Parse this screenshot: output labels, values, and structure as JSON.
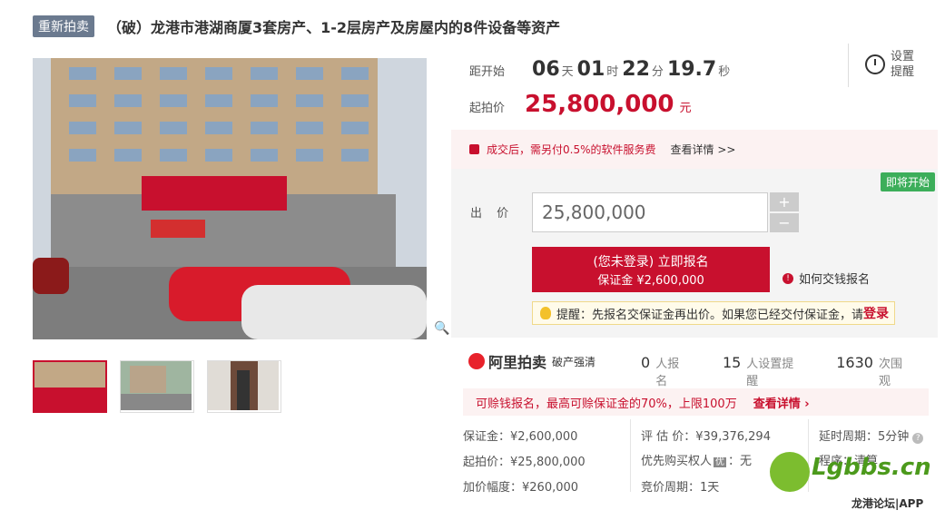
{
  "header": {
    "tag": "重新拍卖",
    "title": "（破）龙港市港湖商厦3套房产、1-2层房产及房屋内的8件设备等资产"
  },
  "countdown": {
    "label": "距开始",
    "days": "06",
    "days_unit": "天",
    "hours": "01",
    "hours_unit": "时",
    "minutes": "22",
    "minutes_unit": "分",
    "seconds": "19.7",
    "seconds_unit": "秒"
  },
  "start_price": {
    "label": "起拍价",
    "value": "25,800,000",
    "unit": "元"
  },
  "reminder": {
    "line1": "设置",
    "line2": "提醒"
  },
  "fee_notice": {
    "text": "成交后，需另付0.5%的软件服务费",
    "link": "查看详情 >>"
  },
  "status_badge": "即将开始",
  "bid": {
    "label": "出 价",
    "value": "25,800,000",
    "plus": "+",
    "minus": "−",
    "signup_line1": "(您未登录) 立即报名",
    "signup_line2": "保证金 ¥2,600,000",
    "how_to": "如何交钱报名"
  },
  "tip": {
    "text": "提醒：先报名交保证金再出价。如果您已经交付保证金，请",
    "login": "登录"
  },
  "brand": {
    "name": "阿里拍卖",
    "sub": "破产强清"
  },
  "stats": [
    {
      "num": "0",
      "label": "人报名"
    },
    {
      "num": "15",
      "label": "人设置提醒"
    },
    {
      "num": "1630",
      "label": "次围观"
    }
  ],
  "refund": {
    "text": "可赊钱报名，最高可赊保证金的70%，上限100万",
    "link": "查看详情 ›"
  },
  "info": {
    "deposit": "保证金：¥2,600,000",
    "start": "起拍价：¥25,800,000",
    "increment": "加价幅度：¥260,000",
    "appraisal": "评 估 价：¥39,376,294",
    "priority": "优先购买权人",
    "priority_tag": "优",
    "priority_value": "：无",
    "cycle": "竞价周期：1天",
    "delay": "延时周期：5分钟",
    "procedure": "程序：清算"
  },
  "watermark": {
    "brand": "Lgbbs.cn",
    "sub": "龙港论坛|APP"
  },
  "colors": {
    "accent": "#c8102e",
    "badge": "#3cae5a",
    "tag": "#6b7a8f"
  }
}
